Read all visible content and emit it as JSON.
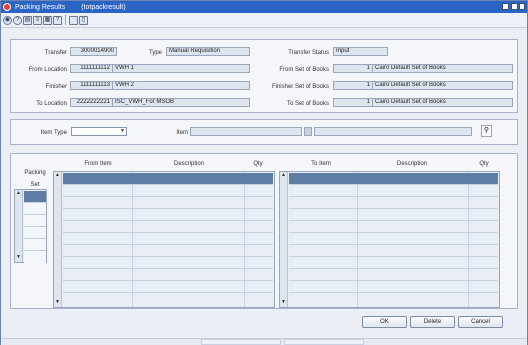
{
  "window": {
    "title": "Packing Results",
    "subtitle": "(totpackresult)"
  },
  "toolbar": {
    "icons": [
      "globe-icon",
      "help-icon",
      "print-icon",
      "list-icon",
      "document-icon",
      "question-icon",
      "blank-icon",
      "page-icon"
    ]
  },
  "header": {
    "transfer_label": "Transfer",
    "transfer_value": "3000014900",
    "type_label": "Type",
    "type_value": "Manual Requisition",
    "transfer_status_label": "Transfer Status",
    "transfer_status_value": "Input",
    "from_location_label": "From Location",
    "from_location_id": "1111111112",
    "from_location_name": "VWH 1",
    "from_sob_label": "From Set of Books",
    "from_sob_id": "1",
    "from_sob_name": "Cairo Default Set of Books",
    "finisher_label": "Finisher",
    "finisher_id": "1111111113",
    "finisher_name": "VWH 2",
    "finisher_sob_label": "Finisher Set of Books",
    "finisher_sob_id": "1",
    "finisher_sob_name": "Cairo Default Set of Books",
    "to_location_label": "To Location",
    "to_location_id": "2222222221",
    "to_location_name": "ISC_VWH_For MSOB",
    "to_sob_label": "To Set of Books",
    "to_sob_id": "1",
    "to_sob_name": "Cairo Default Set of Books"
  },
  "filter": {
    "item_type_label": "Item Type",
    "item_type_value": "",
    "item_label": "Item",
    "item_value": "",
    "item_desc": ""
  },
  "packing": {
    "label_line1": "Packing",
    "label_line2": "Set"
  },
  "from_grid": {
    "headers": [
      "From Item",
      "Description",
      "Qty"
    ]
  },
  "to_grid": {
    "headers": [
      "To Item",
      "Description",
      "Qty"
    ]
  },
  "buttons": {
    "ok_label": "OK",
    "delete_label": "Delete",
    "cancel_label": "Cancel"
  },
  "colors": {
    "titlebar": "#2a64c4",
    "selected_row": "#5f7da6",
    "field_bg": "#dde4ee"
  }
}
